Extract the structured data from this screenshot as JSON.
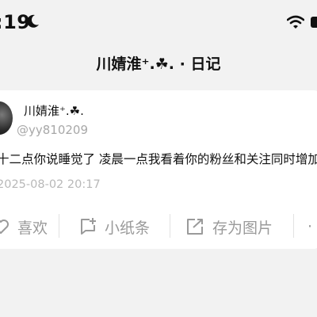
{
  "status_bar": {
    "time": ":19",
    "icons": [
      "moon-icon",
      "wifi-icon",
      "battery-icon"
    ]
  },
  "nav": {
    "title": "川婧淮⁺.☘. · 日记"
  },
  "post": {
    "user_name": "川婧淮⁺.☘.",
    "user_handle": "@yy810209",
    "text": "十二点你说睡觉了 凌晨一点我看着你的粉丝和关注同时增加了",
    "date": "2025-08-02 20:17"
  },
  "actions": {
    "like": {
      "label": "喜欢",
      "icon": "heart-icon"
    },
    "note": {
      "label": "小纸条",
      "icon": "note-add-icon"
    },
    "save_image": {
      "label": "存为图片",
      "icon": "export-image-icon"
    },
    "more": {
      "label": "·",
      "icon": "more-icon"
    }
  },
  "colors": {
    "background": "#f2f2f2",
    "card": "#ffffff",
    "muted_text": "#9a9a9a",
    "primary_text": "#111111"
  }
}
